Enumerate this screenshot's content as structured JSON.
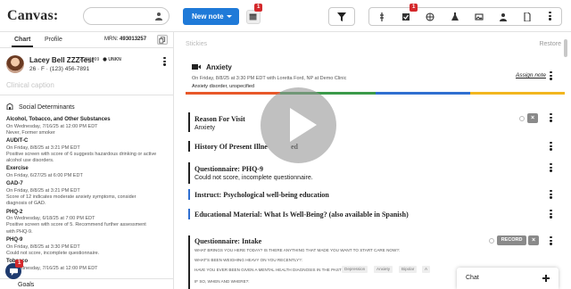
{
  "app": {
    "logo_text": "Canvas:"
  },
  "topbar": {
    "new_note_label": "New note",
    "calendar_badge": "1",
    "toolbar_badge": "1",
    "icons": [
      "staff-icon",
      "checkbox-icon",
      "globe-icon",
      "flask-icon",
      "image-icon",
      "person-icon",
      "document-icon",
      "kebab-icon"
    ]
  },
  "left": {
    "tabs": [
      "Chart",
      "Profile"
    ],
    "mrn_label": "MRN:",
    "mrn_value": "493013257",
    "patient": {
      "name": "Lacey Bell ZZZTest",
      "dob": "2/28/1999",
      "status": "UNKN",
      "info": "26 · F · (123) 456-7891"
    },
    "caption_placeholder": "Clinical caption",
    "section_title": "Social Determinants",
    "items": [
      {
        "title": "Alcohol, Tobacco, and Other Substances",
        "lines": [
          "On Wednesday, 7/16/25 at 12:00 PM EDT",
          "Never, Former smoker"
        ]
      },
      {
        "title": "AUDIT-C",
        "lines": [
          "On Friday, 8/8/25 at 3:21 PM EDT",
          "Positive screen with score of 6 suggests hazardous drinking or active",
          "alcohol use disorders."
        ]
      },
      {
        "title": "Exercise",
        "lines": [
          "On Friday, 6/27/25 at 6:00 PM EDT"
        ]
      },
      {
        "title": "GAD-7",
        "lines": [
          "On Friday, 8/8/25 at 3:21 PM EDT",
          "Score of 12 indicates moderate anxiety symptoms, consider",
          "diagnosis of GAD."
        ]
      },
      {
        "title": "PHQ-2",
        "lines": [
          "On Wednesday, 6/18/25 at 7:00 PM EDT",
          "Positive screen with score of 5. Recommend further assessment",
          "with PHQ-9."
        ]
      },
      {
        "title": "PHQ-9",
        "lines": [
          "On Friday, 8/8/25 at 3:30 PM EDT",
          "Could not score, incomplete questionnaire."
        ]
      },
      {
        "title": "Tobacco",
        "lines": [
          "On Wednesday, 7/16/25 at 12:00 PM EDT"
        ]
      }
    ],
    "goals_label": "Goals",
    "chat_badge": "1"
  },
  "main": {
    "stickies_label": "Stickies",
    "restore_label": "Restore",
    "note": {
      "title": "Anxiety",
      "meta": "On Friday, 8/8/25 at 3:30 PM EDT with Loretta Ford, NP at Demo Clinic",
      "diagnosis": "Anxiety disorder, unspecified",
      "assign_label": "Assign note"
    },
    "commands": [
      {
        "label": "Reason For Visit",
        "sub": "Anxiety"
      },
      {
        "label": "History Of Present Illness",
        "label_visible": "History Of Present Illne",
        "label_tail": "ed"
      },
      {
        "label": "Questionnaire: PHQ-9",
        "sub": "Could not score, incomplete questionnaire."
      },
      {
        "label": "Instruct: Psychological well-being education"
      },
      {
        "label": "Educational Material: What Is Well-Being? (also available in Spanish)"
      },
      {
        "label": "Questionnaire: Intake",
        "record_label": "RECORD",
        "q1": "WHAT BRINGS YOU HERE TODAY? IS THERE ANYTHING THAT MADE YOU WANT TO START CARE NOW?:",
        "q2": "WHAT'S BEEN WEIGHING HEAVY ON YOU RECENTLY?:",
        "q3": "HAVE YOU EVER BEEN GIVEN A MENTAL HEALTH DIAGNOSIS IN THE PAST?:",
        "options": [
          "Depression",
          "Anxiety",
          "Bipolar",
          "A"
        ],
        "q4": "IF SO, WHEN AND WHERE?:"
      }
    ],
    "colorbar": [
      "#e8582a",
      "#3b9a4a",
      "#2f6fd0",
      "#f2b61f"
    ]
  },
  "chat": {
    "label": "Chat"
  }
}
